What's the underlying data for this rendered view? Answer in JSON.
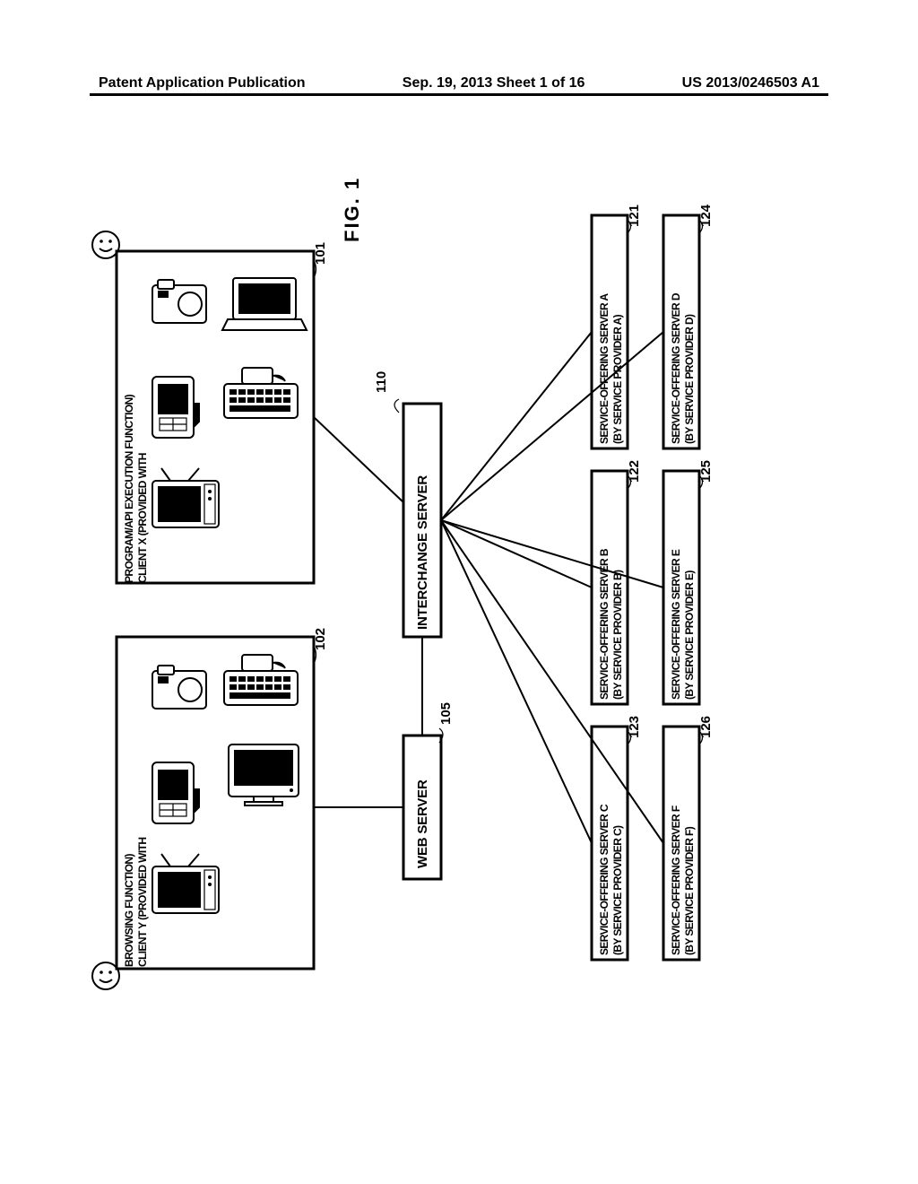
{
  "header": {
    "left": "Patent Application Publication",
    "center": "Sep. 19, 2013  Sheet 1 of 16",
    "right": "US 2013/0246503 A1"
  },
  "figure": {
    "label": "FIG. 1"
  },
  "refs": {
    "r101": "101",
    "r102": "102",
    "r105": "105",
    "r110": "110",
    "r121": "121",
    "r122": "122",
    "r123": "123",
    "r124": "124",
    "r125": "125",
    "r126": "126"
  },
  "clients": {
    "x": {
      "line1": "CLIENT X (PROVIDED WITH",
      "line2": "PROGRAM/API EXECUTION FUNCTION)"
    },
    "y": {
      "line1": "CLIENT Y (PROVIDED WITH",
      "line2": "BROWSING FUNCTION)"
    }
  },
  "middle": {
    "interchange": "INTERCHANGE SERVER",
    "webserver": "WEB SERVER"
  },
  "servers": [
    {
      "l1": "SERVICE-OFFERING SERVER A",
      "l2": "(BY SERVICE PROVIDER A)"
    },
    {
      "l1": "SERVICE-OFFERING SERVER B",
      "l2": "(BY SERVICE PROVIDER B)"
    },
    {
      "l1": "SERVICE-OFFERING SERVER C",
      "l2": "(BY SERVICE PROVIDER C)"
    },
    {
      "l1": "SERVICE-OFFERING SERVER D",
      "l2": "(BY SERVICE PROVIDER D)"
    },
    {
      "l1": "SERVICE-OFFERING SERVER E",
      "l2": "(BY SERVICE PROVIDER E)"
    },
    {
      "l1": "SERVICE-OFFERING SERVER F",
      "l2": "(BY SERVICE PROVIDER F)"
    }
  ]
}
